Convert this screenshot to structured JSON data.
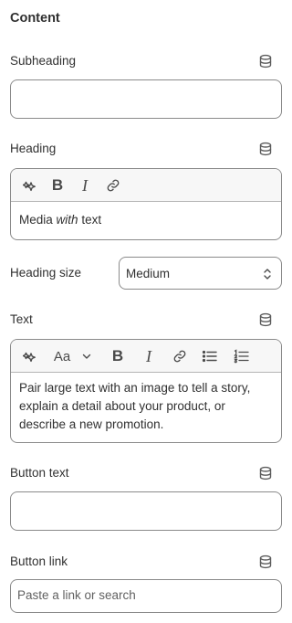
{
  "section": {
    "title": "Content"
  },
  "subheading": {
    "label": "Subheading",
    "value": "",
    "icon": "database-icon"
  },
  "heading": {
    "label": "Heading",
    "icon": "database-icon",
    "toolbar": [
      "magic-sparkle-icon",
      "bold-icon",
      "italic-icon",
      "link-icon"
    ],
    "value_pre": "Media",
    "value_em": "with",
    "value_post": "text"
  },
  "heading_size": {
    "label": "Heading size",
    "selected": "Medium"
  },
  "text": {
    "label": "Text",
    "icon": "database-icon",
    "toolbar": [
      "magic-sparkle-icon",
      "font-size-icon",
      "chevron-down-icon",
      "bold-icon",
      "italic-icon",
      "link-icon",
      "bullet-list-icon",
      "numbered-list-icon"
    ],
    "font_size_label": "Aa",
    "value": "Pair large text with an image to tell a story, explain a detail about your product, or describe a new promotion."
  },
  "button_text": {
    "label": "Button text",
    "value": "",
    "icon": "database-icon"
  },
  "button_link": {
    "label": "Button link",
    "placeholder": "Paste a link or search",
    "icon": "database-icon"
  }
}
